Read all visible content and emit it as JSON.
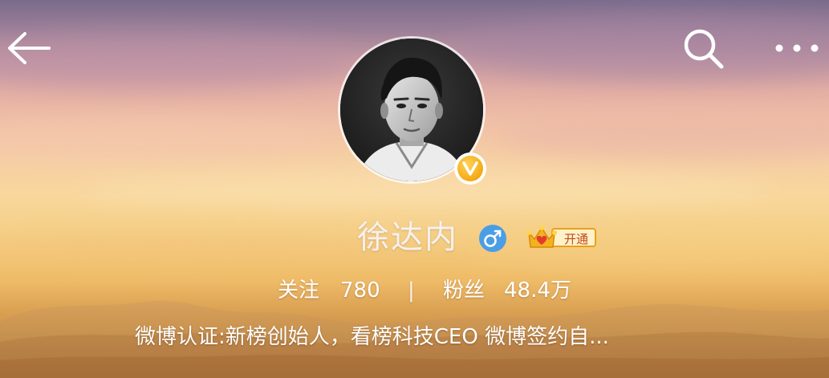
{
  "header": {
    "back_icon": "back-arrow-icon",
    "search_icon": "search-icon",
    "more_icon": "more-dots-icon"
  },
  "profile": {
    "avatar_icon": "avatar",
    "verified_badge_text": "V",
    "verified_color": "#f4a912",
    "username": "徐达内",
    "gender_icon": "male-icon",
    "gender_color": "#4a9ee6",
    "vip_label": "开通",
    "vip_color": "#e8a11a"
  },
  "stats": {
    "follow_label": "关注",
    "follow_count": "780",
    "divider": "|",
    "fans_label": "粉丝",
    "fans_count": "48.4万"
  },
  "bio": "微博认证:新榜创始人，看榜科技CEO 微博签约自..."
}
